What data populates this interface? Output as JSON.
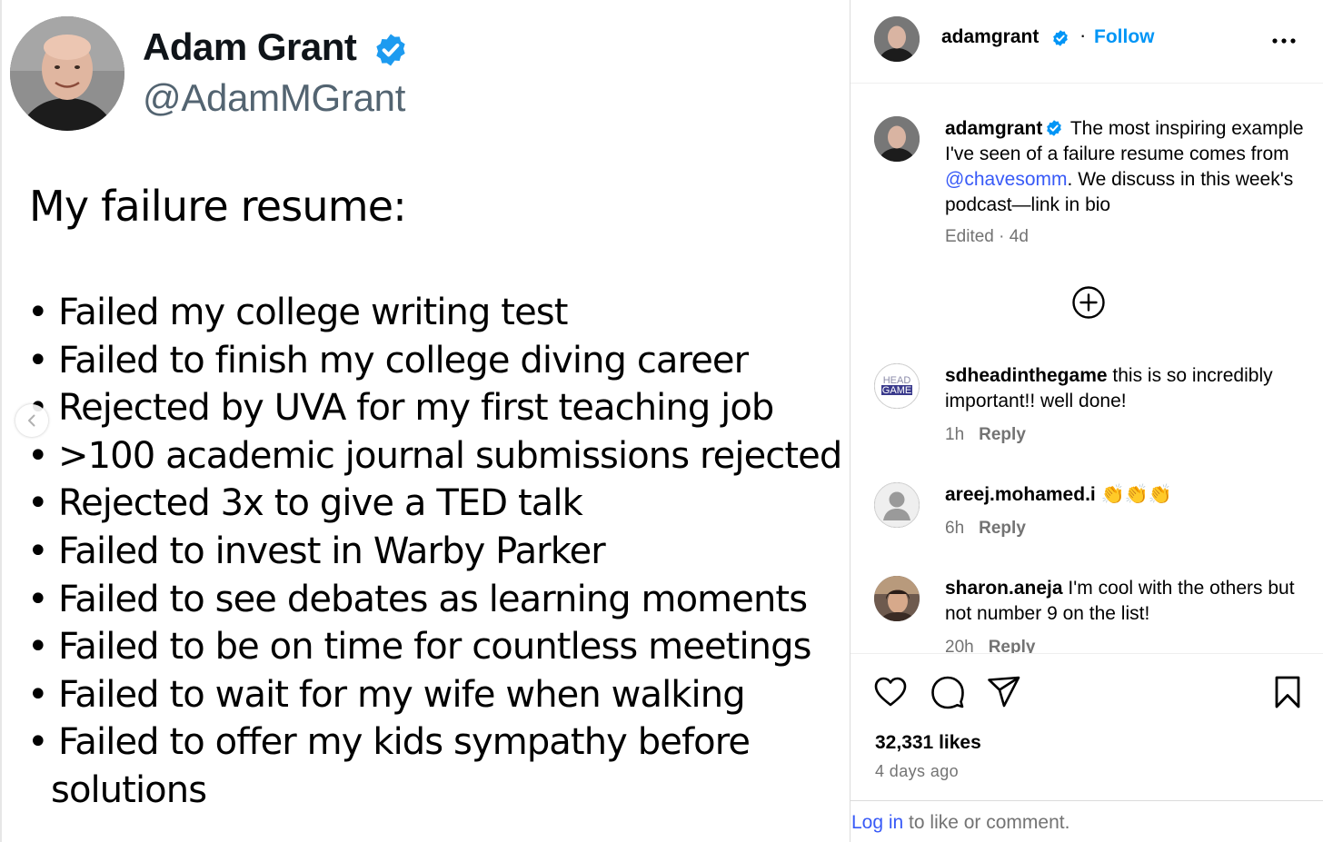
{
  "tweet": {
    "name": "Adam Grant",
    "handle": "@AdamMGrant",
    "heading": "My failure resume:",
    "items": [
      "Failed my college writing test",
      "Failed to finish my college diving career",
      "Rejected by UVA for my first teaching job",
      ">100 academic journal submissions rejected",
      "Rejected 3x to give a TED talk",
      "Failed to invest in Warby Parker",
      "Failed to see debates as learning moments",
      "Failed to be on time for countless meetings",
      "Failed to wait for my wife when walking",
      "Failed to offer my kids sympathy before"
    ],
    "continuation": "solutions",
    "bullet": "•"
  },
  "header": {
    "username": "adamgrant",
    "dot": "·",
    "follow_label": "Follow"
  },
  "caption": {
    "username": "adamgrant",
    "text_before": "The most inspiring example I've seen of a failure resume comes from ",
    "mention": "@chavesomm",
    "text_after": ". We discuss in this week's podcast—link in bio",
    "meta": "Edited · 4d"
  },
  "comments": [
    {
      "username": "sdheadinthegame",
      "text": "this is so incredibly important!! well done!",
      "time": "1h",
      "reply": "Reply"
    },
    {
      "username": "areej.mohamed.i",
      "text": "👏👏👏",
      "time": "6h",
      "reply": "Reply"
    },
    {
      "username": "sharon.aneja",
      "text": "I'm cool with the others but not number 9 on the list!",
      "time": "20h",
      "reply": "Reply"
    }
  ],
  "head_logo": {
    "line1": "HEAD",
    "line2": "GAME"
  },
  "stats": {
    "likes": "32,331 likes",
    "time_ago": "4 days ago"
  },
  "login": {
    "link": "Log in",
    "rest": " to like or comment."
  },
  "colors": {
    "accent": "#0095f6",
    "verified": "#1d9bf0",
    "secondary": "#737373"
  }
}
